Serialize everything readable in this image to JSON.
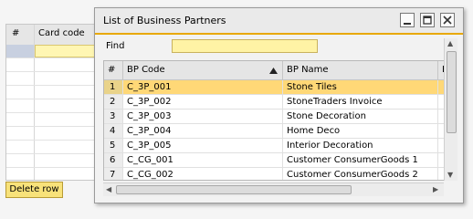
{
  "background": {
    "grid_headers": [
      "#",
      "Card code"
    ],
    "delete_button": "Delete row"
  },
  "dialog": {
    "title": "List of Business Partners",
    "find_label": "Find",
    "find_value": "",
    "columns": [
      "#",
      "BP Code",
      "BP Name",
      "BI"
    ],
    "rows": [
      {
        "num": "1",
        "code": "C_3P_001",
        "name": "Stone Tiles",
        "selected": true
      },
      {
        "num": "2",
        "code": "C_3P_002",
        "name": "StoneTraders Invoice",
        "selected": false
      },
      {
        "num": "3",
        "code": "C_3P_003",
        "name": "Stone Decoration",
        "selected": false
      },
      {
        "num": "4",
        "code": "C_3P_004",
        "name": "Home Deco",
        "selected": false
      },
      {
        "num": "5",
        "code": "C_3P_005",
        "name": "Interior Decoration",
        "selected": false
      },
      {
        "num": "6",
        "code": "C_CG_001",
        "name": "Customer ConsumerGoods 1",
        "selected": false
      },
      {
        "num": "7",
        "code": "C_CG_002",
        "name": "Customer ConsumerGoods 2",
        "selected": false
      }
    ]
  }
}
